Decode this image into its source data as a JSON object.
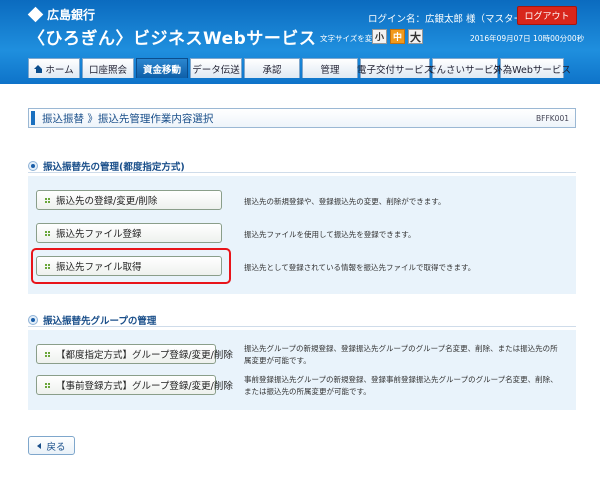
{
  "header": {
    "bank_name": "広島銀行",
    "service_name": "〈ひろぎん〉ビジネスWebサービス",
    "login_name": "ログイン名：広銀太郎 様（マスターユーザ）",
    "logout_label": "ログアウト",
    "font_size_label": "文字サイズを変更",
    "font_small": "小",
    "font_medium": "中",
    "font_large": "大",
    "datetime": "2016年09月07日 10時00分00秒"
  },
  "nav": {
    "tabs": [
      {
        "label": "ホーム"
      },
      {
        "label": "口座照会"
      },
      {
        "label": "資金移動"
      },
      {
        "label": "データ伝送"
      },
      {
        "label": "承認"
      },
      {
        "label": "管理"
      },
      {
        "label": "電子交付サービス"
      },
      {
        "label": "でんさいサービス"
      },
      {
        "label": "外為Webサービス"
      }
    ],
    "active_tab": "資金移動"
  },
  "page": {
    "title": "振込振替 》振込先管理作業内容選択",
    "screen_id": "BFFK001"
  },
  "section1": {
    "heading": "振込振替先の管理(都度指定方式)",
    "items": [
      {
        "label": "振込先の登録/変更/削除",
        "desc": "振込先の新規登録や、登録振込先の変更、削除ができます。"
      },
      {
        "label": "振込先ファイル登録",
        "desc": "振込先ファイルを使用して振込先を登録できます。"
      },
      {
        "label": "振込先ファイル取得",
        "desc": "振込先として登録されている情報を振込先ファイルで取得できます。"
      }
    ]
  },
  "section2": {
    "heading": "振込振替先グループの管理",
    "items": [
      {
        "label": "【都度指定方式】グループ登録/変更/削除",
        "desc_line1": "振込先グループの新規登録、登録振込先グループのグループ名変更、削除、または振込先の所",
        "desc_line2": "属変更が可能です。"
      },
      {
        "label": "【事前登録方式】グループ登録/変更/削除",
        "desc_line1": "事前登録振込先グループの新規登録、登録事前登録振込先グループのグループ名変更、削除、",
        "desc_line2": "または振込先の所属変更が可能です。"
      }
    ]
  },
  "footer": {
    "back_label": "戻る"
  },
  "colors": {
    "header_blue": "#1f8fde",
    "logout_red": "#d8261b",
    "font_medium_orange": "#f29a1b",
    "highlight_red": "#e8141a",
    "section_bg": "#e9f3fb"
  }
}
